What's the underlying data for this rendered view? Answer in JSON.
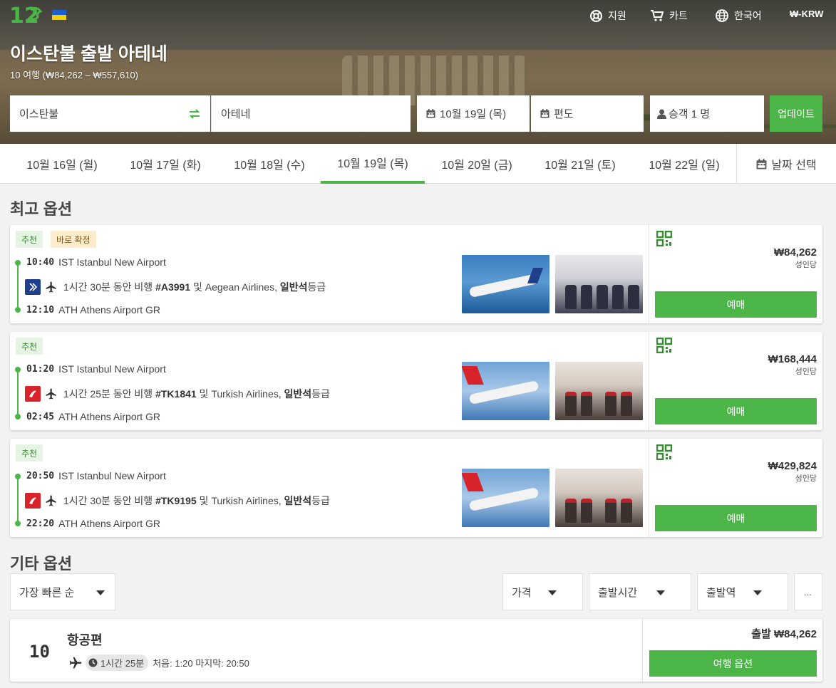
{
  "nav": {
    "support": "지원",
    "cart": "카트",
    "language": "한국어",
    "currency": "₩-KRW"
  },
  "hero": {
    "title": "이스탄불 출발 아테네",
    "subtitle": "10 여행 (₩84,262 – ₩557,610)"
  },
  "search": {
    "from": "이스탄불",
    "to": "아테네",
    "depart_date": "10월 19일 (목)",
    "return_date": "편도",
    "passengers": "승객 1 명",
    "update_label": "업데이트"
  },
  "dates": {
    "tabs": [
      "10월 16일 (월)",
      "10월 17일 (화)",
      "10월 18일 (수)",
      "10월 19일 (목)",
      "10월 20일 (금)",
      "10월 21일 (토)",
      "10월 22일 (일)"
    ],
    "active_index": 3,
    "pick_label": "날짜 선택"
  },
  "best_title": "최고 옵션",
  "other_title": "기타 옵션",
  "results": [
    {
      "badges": [
        "추천",
        "바로 확정"
      ],
      "dep_time": "10:40",
      "dep_place": "IST Istanbul New Airport",
      "flight_prefix": "1시간 30분 동안 비행 ",
      "flight_no": "#A3991",
      "flight_mid": " 및 Aegean Airlines, ",
      "cabin": "일반석",
      "cabin_suffix": "등급",
      "arr_time": "12:10",
      "arr_place": "ATH Athens Airport GR",
      "price": "₩84,262",
      "per": "성인당",
      "book": "예매",
      "airline": "aegean"
    },
    {
      "badges": [
        "추천"
      ],
      "dep_time": "01:20",
      "dep_place": "IST Istanbul New Airport",
      "flight_prefix": "1시간 25분 동안 비행 ",
      "flight_no": "#TK1841",
      "flight_mid": " 및 Turkish Airlines, ",
      "cabin": "일반석",
      "cabin_suffix": "등급",
      "arr_time": "02:45",
      "arr_place": "ATH Athens Airport GR",
      "price": "₩168,444",
      "per": "성인당",
      "book": "예매",
      "airline": "turkish"
    },
    {
      "badges": [
        "추천"
      ],
      "dep_time": "20:50",
      "dep_place": "IST Istanbul New Airport",
      "flight_prefix": "1시간 30분 동안 비행 ",
      "flight_no": "#TK9195",
      "flight_mid": " 및 Turkish Airlines, ",
      "cabin": "일반석",
      "cabin_suffix": "등급",
      "arr_time": "22:20",
      "arr_place": "ATH Athens Airport GR",
      "price": "₩429,824",
      "per": "성인당",
      "book": "예매",
      "airline": "turkish"
    }
  ],
  "filters": {
    "sort": "가장 빠른 순",
    "price": "가격",
    "departure_time": "출발시간",
    "station": "출발역",
    "more": "..."
  },
  "group": {
    "count": "10",
    "title": "항공편",
    "duration": "1시간 25분",
    "range": "처음: 1:20 마지막: 20:50",
    "price": "출발 ₩84,262",
    "button": "여행 옵션"
  },
  "colors": {
    "accent": "#4bb548",
    "aegean": "#1f3f8a",
    "turkish": "#d9232b"
  }
}
